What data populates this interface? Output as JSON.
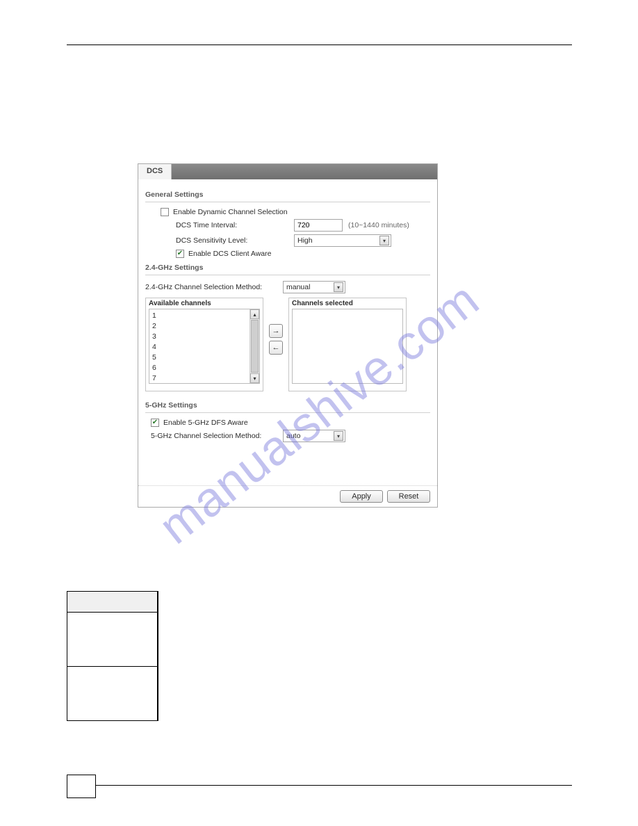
{
  "watermark": "manualshive.com",
  "window": {
    "tab": "DCS",
    "general": {
      "title": "General Settings",
      "enable_dcs_label": "Enable Dynamic Channel Selection",
      "time_interval_label": "DCS Time Interval:",
      "time_interval_value": "720",
      "time_interval_note": "(10~1440 minutes)",
      "sensitivity_label": "DCS Sensitivity Level:",
      "sensitivity_value": "High",
      "client_aware_label": "Enable DCS Client Aware"
    },
    "g24": {
      "title": "2.4-GHz Settings",
      "method_label": "2.4-GHz Channel Selection Method:",
      "method_value": "manual",
      "avail_legend": "Available channels",
      "sel_legend": "Channels selected",
      "channels": [
        "1",
        "2",
        "3",
        "4",
        "5",
        "6",
        "7"
      ]
    },
    "g5": {
      "title": "5-GHz Settings",
      "dfs_label": "Enable 5-GHz DFS Aware",
      "method_label": "5-GHz Channel Selection Method:",
      "method_value": "auto"
    },
    "buttons": {
      "apply": "Apply",
      "reset": "Reset"
    }
  }
}
